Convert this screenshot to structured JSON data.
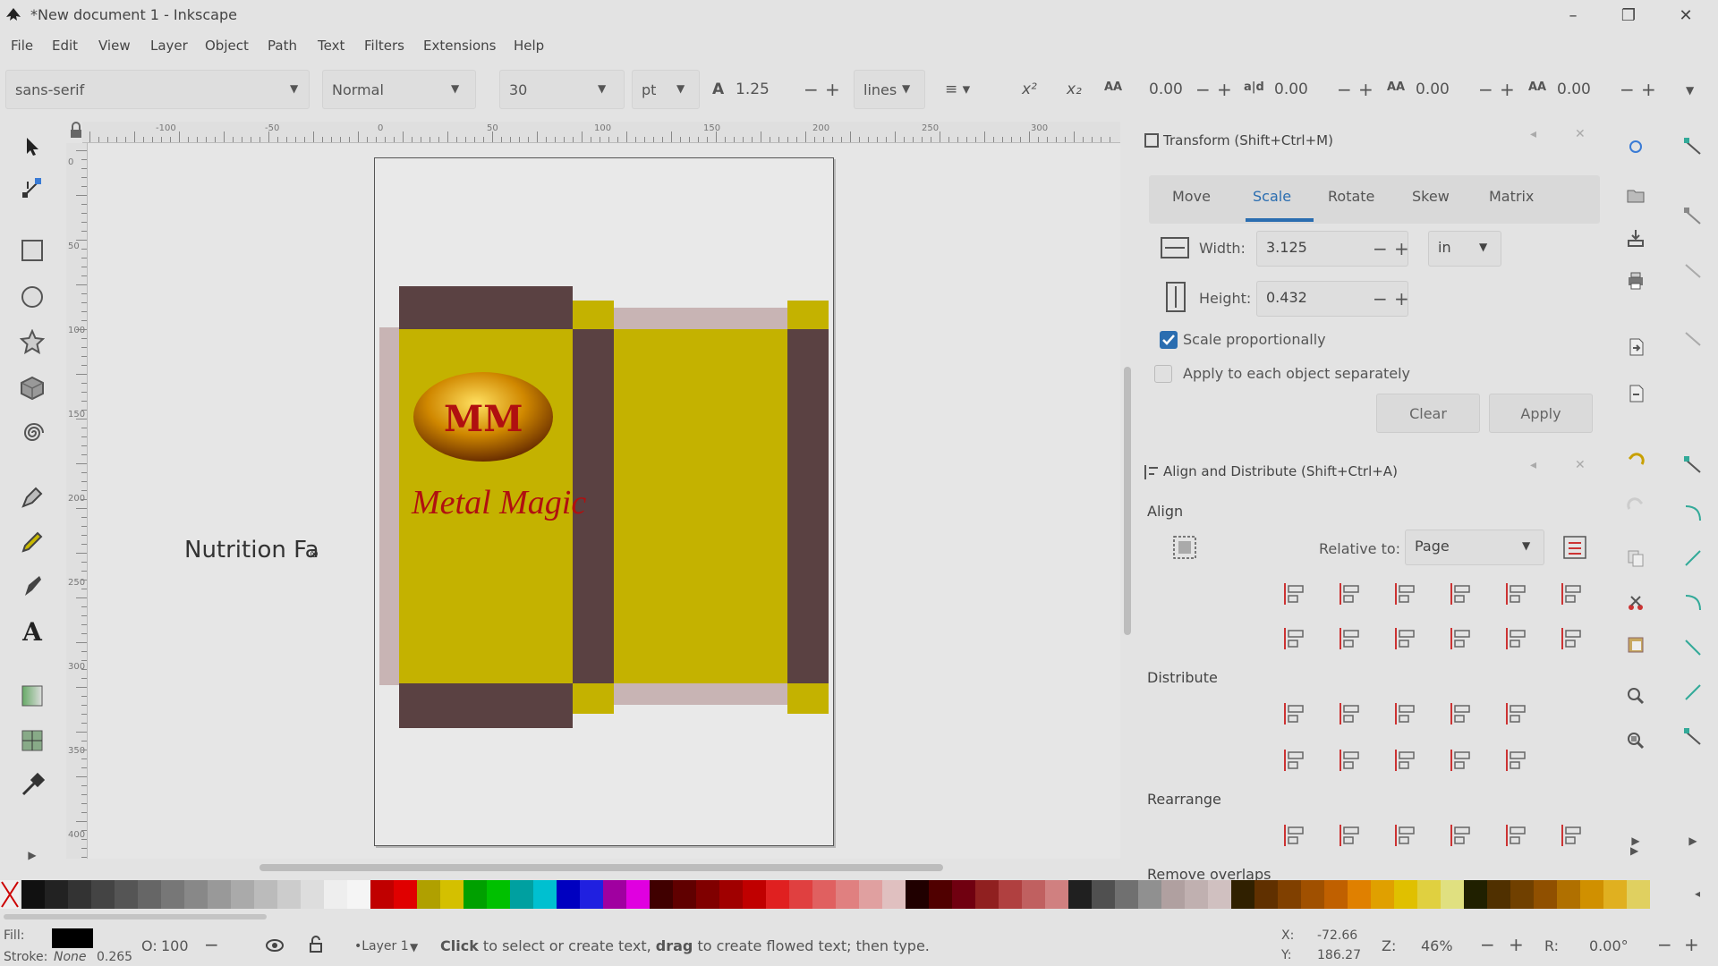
{
  "window": {
    "title": "*New document 1 - Inkscape",
    "minimize": "–",
    "maximize": "❐",
    "close": "✕"
  },
  "menu": [
    "File",
    "Edit",
    "View",
    "Layer",
    "Object",
    "Path",
    "Text",
    "Filters",
    "Extensions",
    "Help"
  ],
  "text_toolbar": {
    "font_family": "sans-serif",
    "font_style": "Normal",
    "font_size": "30",
    "unit": "pt",
    "line_spacing": "1.25",
    "spacing_mode": "lines",
    "letter_spacing": "0.00",
    "word_spacing": "0.00",
    "kerning_h": "0.00",
    "kerning_v": "0.00"
  },
  "ruler": {
    "h_labels": [
      "-100",
      "-50",
      "0",
      "50",
      "100",
      "150",
      "200",
      "250",
      "300"
    ],
    "v_labels": [
      "0",
      "50",
      "100",
      "150",
      "200",
      "250",
      "300",
      "350",
      "400"
    ]
  },
  "canvas": {
    "logo_text": "MM",
    "brand_text": "Metal Magic",
    "typing_text": "Nutrition Fa",
    "colors": {
      "yellow": "#c4b200",
      "brown": "#5a4142",
      "red": "#b01010"
    }
  },
  "transform": {
    "title": "Transform (Shift+Ctrl+M)",
    "tabs": [
      "Move",
      "Scale",
      "Rotate",
      "Skew",
      "Matrix"
    ],
    "active_tab": "Scale",
    "width_label": "Width:",
    "width_value": "3.125",
    "height_label": "Height:",
    "height_value": "0.432",
    "unit": "in",
    "scale_proportionally_label": "Scale proportionally",
    "scale_proportionally_checked": true,
    "apply_each_label": "Apply to each object separately",
    "apply_each_checked": false,
    "clear_label": "Clear",
    "apply_label": "Apply"
  },
  "align": {
    "title": "Align and Distribute (Shift+Ctrl+A)",
    "section_align": "Align",
    "relative_label": "Relative to:",
    "relative_value": "Page",
    "section_distribute": "Distribute",
    "section_rearrange": "Rearrange",
    "section_overlaps": "Remove overlaps"
  },
  "status": {
    "fill_label": "Fill:",
    "stroke_label": "Stroke:",
    "stroke_value": "None",
    "stroke_width": "0.265",
    "opacity_label": "O:",
    "opacity_value": "100",
    "layer_name": "•Layer 1",
    "message_parts": [
      "Click",
      " to select or create text, ",
      "drag",
      " to create flowed text; then type."
    ],
    "x_label": "X:",
    "x_value": "-72.66",
    "y_label": "Y:",
    "y_value": "186.27",
    "zoom_label": "Z:",
    "zoom_value": "46%",
    "rotation_label": "R:",
    "rotation_value": "0.00°"
  },
  "palette_colors": [
    "#111111",
    "#222222",
    "#333333",
    "#444444",
    "#555555",
    "#666666",
    "#777777",
    "#888888",
    "#999999",
    "#aaaaaa",
    "#bbbbbb",
    "#cccccc",
    "#dddddd",
    "#eeeeee",
    "#f5f5f5",
    "#c00000",
    "#e00000",
    "#b0a000",
    "#d4c000",
    "#00a000",
    "#00c000",
    "#00a0a0",
    "#00c0d0",
    "#0000c0",
    "#2020e0",
    "#a000a0",
    "#e000e0",
    "#400000",
    "#600000",
    "#800000",
    "#a00000",
    "#c00000",
    "#e02020",
    "#e04040",
    "#e06060",
    "#e08080",
    "#e0a0a0",
    "#e0c0c0",
    "#200000",
    "#500000",
    "#700010",
    "#902020",
    "#b04040",
    "#c06060",
    "#d08080",
    "#202020",
    "#505050",
    "#707070",
    "#909090",
    "#b0a0a0",
    "#c0b0b0",
    "#d0c0c0",
    "#302000",
    "#603000",
    "#804000",
    "#a05000",
    "#c06000",
    "#e08000",
    "#e0a000",
    "#e0c000",
    "#e0d040",
    "#e0e080",
    "#202000",
    "#503000",
    "#704000",
    "#905000",
    "#b07000",
    "#d09000",
    "#e0b020",
    "#e0d060"
  ]
}
